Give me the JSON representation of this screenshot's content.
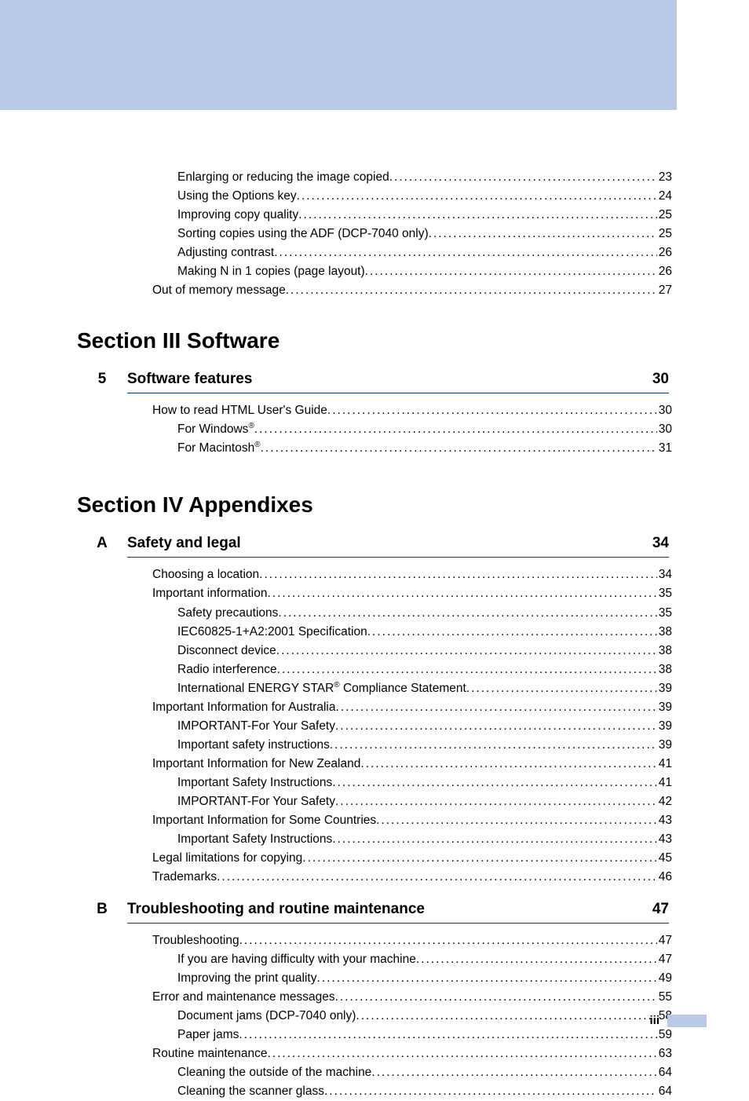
{
  "top_entries": [
    {
      "label": "Enlarging or reducing the image copied",
      "page": "23",
      "indent": 2
    },
    {
      "label": "Using the Options key",
      "page": "24",
      "indent": 2
    },
    {
      "label": "Improving copy quality",
      "page": "25",
      "indent": 2
    },
    {
      "label": "Sorting copies using the ADF (DCP-7040 only)",
      "page": "25",
      "indent": 2
    },
    {
      "label": "Adjusting contrast",
      "page": "26",
      "indent": 2
    },
    {
      "label": "Making N in 1 copies (page layout)",
      "page": "26",
      "indent": 2
    },
    {
      "label": "Out of memory message",
      "page": "27",
      "indent": 1
    }
  ],
  "section3": {
    "title": "Section III  Software",
    "chapter": {
      "num": "5",
      "title": "Software features",
      "page": "30"
    },
    "entries": [
      {
        "label": "How to read HTML User's Guide",
        "page": "30",
        "indent": 1
      },
      {
        "label": "For Windows",
        "sup": "®",
        "page": "30",
        "indent": 2
      },
      {
        "label": "For Macintosh",
        "sup": "®",
        "page": "31",
        "indent": 2
      }
    ]
  },
  "section4": {
    "title": "Section IV Appendixes",
    "chapterA": {
      "num": "A",
      "title": "Safety and legal",
      "page": "34"
    },
    "entriesA": [
      {
        "label": "Choosing a location",
        "page": "34",
        "indent": 1
      },
      {
        "label": "Important information",
        "page": "35",
        "indent": 1
      },
      {
        "label": "Safety precautions",
        "page": "35",
        "indent": 2
      },
      {
        "label": "IEC60825-1+A2:2001 Specification",
        "page": "38",
        "indent": 2
      },
      {
        "label": "Disconnect device",
        "page": "38",
        "indent": 2
      },
      {
        "label": "Radio interference",
        "page": "38",
        "indent": 2
      },
      {
        "label": "International ENERGY STAR",
        "sup": "®",
        "tail": " Compliance Statement",
        "page": "39",
        "indent": 2
      },
      {
        "label": "Important Information for Australia",
        "page": "39",
        "indent": 1
      },
      {
        "label": "IMPORTANT-For Your Safety",
        "page": "39",
        "indent": 2
      },
      {
        "label": "Important safety instructions",
        "page": "39",
        "indent": 2
      },
      {
        "label": "Important Information for New Zealand",
        "page": "41",
        "indent": 1
      },
      {
        "label": "Important Safety Instructions",
        "page": "41",
        "indent": 2
      },
      {
        "label": "IMPORTANT-For Your Safety",
        "page": "42",
        "indent": 2
      },
      {
        "label": "Important Information for Some Countries",
        "page": "43",
        "indent": 1
      },
      {
        "label": "Important Safety Instructions",
        "page": "43",
        "indent": 2
      },
      {
        "label": "Legal limitations for copying",
        "page": "45",
        "indent": 1
      },
      {
        "label": "Trademarks",
        "page": "46",
        "indent": 1
      }
    ],
    "chapterB": {
      "num": "B",
      "title": "Troubleshooting and routine maintenance",
      "page": "47"
    },
    "entriesB": [
      {
        "label": "Troubleshooting",
        "page": "47",
        "indent": 1
      },
      {
        "label": "If you are having difficulty with your machine",
        "page": "47",
        "indent": 2
      },
      {
        "label": "Improving the print quality",
        "page": "49",
        "indent": 2
      },
      {
        "label": "Error and maintenance messages",
        "page": "55",
        "indent": 1
      },
      {
        "label": "Document jams (DCP-7040 only)",
        "page": "58",
        "indent": 2
      },
      {
        "label": "Paper jams",
        "page": "59",
        "indent": 2
      },
      {
        "label": "Routine maintenance",
        "page": "63",
        "indent": 1
      },
      {
        "label": "Cleaning the outside of the machine",
        "page": "64",
        "indent": 2
      },
      {
        "label": "Cleaning the scanner glass",
        "page": "64",
        "indent": 2
      }
    ]
  },
  "footer": {
    "page_number": "iii"
  }
}
